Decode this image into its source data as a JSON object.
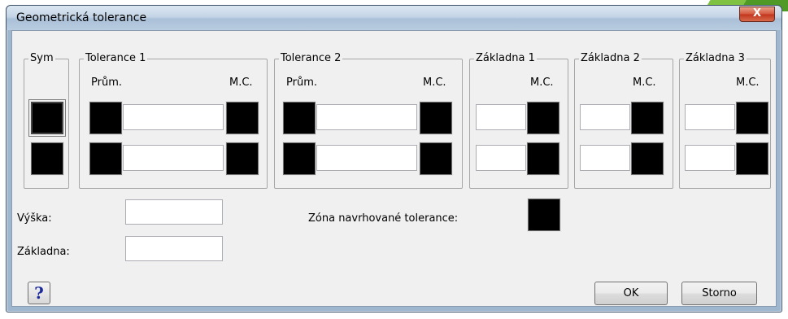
{
  "dialog": {
    "title": "Geometrická tolerance",
    "close_glyph": "X"
  },
  "groups": {
    "sym": "Sym",
    "tol1": "Tolerance 1",
    "tol2": "Tolerance 2",
    "datum1": "Základna 1",
    "datum2": "Základna 2",
    "datum3": "Základna 3"
  },
  "headers": {
    "dia": "Prům.",
    "mc": "M.C."
  },
  "fields": {
    "height_label": "Výška:",
    "height_value": "",
    "datum_label": "Základna:",
    "datum_value": "",
    "projected_zone_label": "Zóna navrhované tolerance:"
  },
  "buttons": {
    "help": "?",
    "ok": "OK",
    "cancel": "Storno"
  },
  "colors": {
    "swatch": "#000000",
    "help_glyph": "#1a2a9c"
  }
}
